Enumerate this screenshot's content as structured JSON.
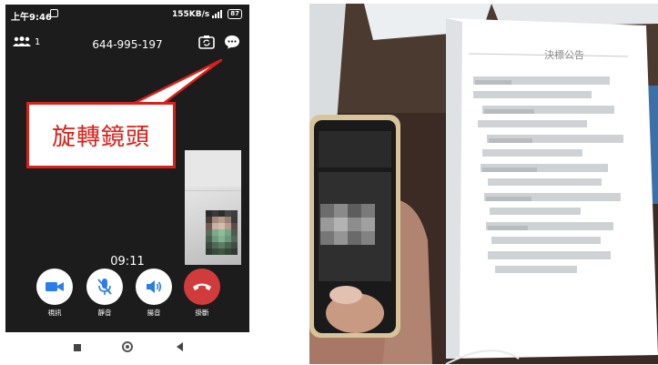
{
  "status_bar": {
    "time": "上午9:46",
    "network": "155KB/s",
    "battery": "87"
  },
  "call": {
    "participant_count": "1",
    "meeting_id": "644-995-197",
    "timer": "09:11"
  },
  "annotation": {
    "text": "旋轉鏡頭",
    "color": "#d9201a"
  },
  "controls": [
    {
      "label": "視訊",
      "icon": "video-camera-icon"
    },
    {
      "label": "靜音",
      "icon": "microphone-muted-icon"
    },
    {
      "label": "揚音",
      "icon": "speaker-icon"
    },
    {
      "label": "掛斷",
      "icon": "hang-up-icon"
    }
  ],
  "photo": {
    "document_title": "決標公告"
  },
  "colors": {
    "accent_blue": "#2b7de9",
    "hangup_red": "#d23b3b",
    "phone_bg": "#1c1c1c"
  }
}
